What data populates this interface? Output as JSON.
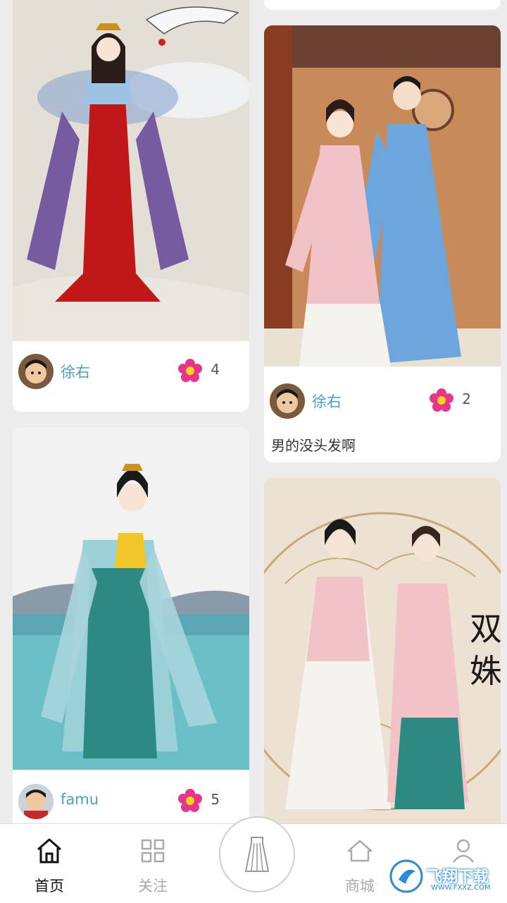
{
  "feed": {
    "left_column": [
      {
        "author": "徐右",
        "likes": "4"
      },
      {
        "author": "famu",
        "likes": "5"
      }
    ],
    "right_column": [
      {
        "author": "徐右",
        "likes": "2",
        "caption": "男的没头发啊"
      },
      {
        "calligraphy": "双姝"
      }
    ]
  },
  "tabbar": {
    "home": "首页",
    "follow": "关注",
    "mall": "商城",
    "profile": ""
  },
  "watermark": {
    "text": "飞翔下载",
    "url": "WWW.FXXZ.COM"
  },
  "colors": {
    "accent_name": "#4a9cc9",
    "like_flower": "#e8348a",
    "background": "#ececec"
  }
}
